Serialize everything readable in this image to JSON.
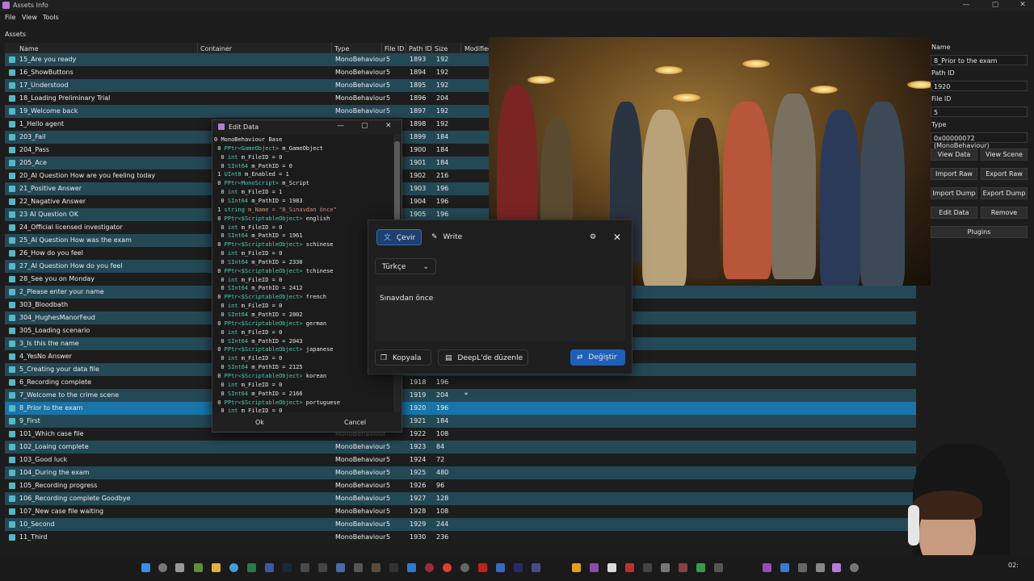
{
  "window": {
    "title": "Assets Info",
    "minimize": "—",
    "maximize": "▢",
    "close": "✕"
  },
  "menu": [
    "File",
    "View",
    "Tools"
  ],
  "assets_label": "Assets",
  "table": {
    "headers": [
      "Name",
      "Container",
      "Type",
      "File ID",
      "Path ID",
      "Size",
      "Modified"
    ],
    "rows": [
      [
        "15_Are you ready",
        "",
        "MonoBehaviour",
        "5",
        "1893",
        "192"
      ],
      [
        "16_ShowButtons",
        "",
        "MonoBehaviour",
        "5",
        "1894",
        "192"
      ],
      [
        "17_Understood",
        "",
        "MonoBehaviour",
        "5",
        "1895",
        "192"
      ],
      [
        "18_Loading Preliminary Trial",
        "",
        "MonoBehaviour",
        "5",
        "1896",
        "204"
      ],
      [
        "19_Welcome back",
        "",
        "MonoBehaviour",
        "5",
        "1897",
        "192"
      ],
      [
        "1_Hello agent",
        "",
        "",
        "",
        "1898",
        "192"
      ],
      [
        "203_Fail",
        "",
        "",
        "",
        "1899",
        "184"
      ],
      [
        "204_Pass",
        "",
        "",
        "",
        "1900",
        "184"
      ],
      [
        "205_Ace",
        "",
        "",
        "",
        "1901",
        "184"
      ],
      [
        "20_AI Question How are you feeling today",
        "",
        "",
        "",
        "1902",
        "216"
      ],
      [
        "21_Positive Answer",
        "",
        "",
        "",
        "1903",
        "196"
      ],
      [
        "22_Nagative Answer",
        "",
        "",
        "",
        "1904",
        "196"
      ],
      [
        "23 AI Question OK",
        "",
        "",
        "",
        "1905",
        "196"
      ],
      [
        "24_Official licensed investigator",
        "",
        "",
        "",
        "",
        ""
      ],
      [
        "25_AI Question How was the exam",
        "",
        "",
        "",
        "",
        ""
      ],
      [
        "26_How do you feel",
        "",
        "",
        "",
        "",
        ""
      ],
      [
        "27_AI Question How do you feel",
        "",
        "",
        "",
        "",
        ""
      ],
      [
        "28_See you on Monday",
        "",
        "",
        "",
        "",
        ""
      ],
      [
        "2_Please enter your name",
        "",
        "",
        "",
        "",
        ""
      ],
      [
        "303_Bloodbath",
        "",
        "",
        "",
        "",
        ""
      ],
      [
        "304_HughesManorFeud",
        "",
        "",
        "",
        "",
        ""
      ],
      [
        "305_Loading scenario",
        "",
        "",
        "",
        "",
        ""
      ],
      [
        "3_Is this the name",
        "",
        "",
        "",
        "",
        ""
      ],
      [
        "4_YesNo Answer",
        "",
        "",
        "",
        "",
        ""
      ],
      [
        "5_Creating your data file",
        "",
        "",
        "",
        "",
        ""
      ],
      [
        "6_Recording complete",
        "",
        "",
        "",
        "1918",
        "196"
      ],
      [
        "7_Welcome to the crime scene",
        "",
        "",
        "",
        "1919",
        "204"
      ],
      [
        "8_Prior to the exam",
        "",
        "",
        "",
        "1920",
        "196"
      ],
      [
        "9_First",
        "",
        "",
        "",
        "1921",
        "184"
      ],
      [
        "101_Which case file",
        "",
        "MonoBehaviour",
        "",
        "1922",
        "108"
      ],
      [
        "102_Loaing complete",
        "",
        "MonoBehaviour",
        "5",
        "1923",
        "84"
      ],
      [
        "103_Good luck",
        "",
        "MonoBehaviour",
        "5",
        "1924",
        "72"
      ],
      [
        "104_During the exam",
        "",
        "MonoBehaviour",
        "5",
        "1925",
        "480"
      ],
      [
        "105_Recording progress",
        "",
        "MonoBehaviour",
        "5",
        "1926",
        "96"
      ],
      [
        "106_Recording complete Goodbye",
        "",
        "MonoBehaviour",
        "5",
        "1927",
        "128"
      ],
      [
        "107_New case file waiting",
        "",
        "MonoBehaviour",
        "5",
        "1928",
        "108"
      ],
      [
        "10_Second",
        "",
        "MonoBehaviour",
        "5",
        "1929",
        "244"
      ],
      [
        "11_Third",
        "",
        "MonoBehaviour",
        "5",
        "1930",
        "236"
      ]
    ],
    "modified_mark": "*"
  },
  "right_panel": {
    "name_label": "Name",
    "name_value": "8_Prior to the exam",
    "pathid_label": "Path ID",
    "pathid_value": "1920",
    "fileid_label": "File ID",
    "fileid_value": "5",
    "type_label": "Type",
    "type_value": "0x00000072 (MonoBehaviour)",
    "buttons": [
      "View Data",
      "View Scene",
      "Import Raw",
      "Export Raw",
      "Import Dump",
      "Export Dump",
      "Edit Data",
      "Remove",
      "Plugins"
    ]
  },
  "edit_dialog": {
    "title": "Edit Data",
    "ok": "Ok",
    "cancel": "Cancel",
    "lines": [
      [
        "0 ",
        "MonoBehaviour Base",
        ""
      ],
      [
        " 0 ",
        "PPtr<GameObject>",
        " m_GameObject"
      ],
      [
        "  0 ",
        "int",
        " m_FileID = 0"
      ],
      [
        "  0 ",
        "SInt64",
        " m_PathID = 0"
      ],
      [
        " 1 ",
        "UInt8",
        " m_Enabled = 1"
      ],
      [
        " 0 ",
        "PPtr<MonoScript>",
        " m_Script"
      ],
      [
        "  0 ",
        "int",
        " m_FileID = 1"
      ],
      [
        "  0 ",
        "SInt64",
        " m_PathID = 1983"
      ],
      [
        " 1 ",
        "string",
        " m_Name = \"8_Sınavdan önce\""
      ],
      [
        " 0 ",
        "PPtr<$ScriptableObject>",
        " english"
      ],
      [
        "  0 ",
        "int",
        " m_FileID = 0"
      ],
      [
        "  0 ",
        "SInt64",
        " m_PathID = 1961"
      ],
      [
        " 0 ",
        "PPtr<$ScriptableObject>",
        " schinese"
      ],
      [
        "  0 ",
        "int",
        " m_FileID = 0"
      ],
      [
        "  0 ",
        "SInt64",
        " m_PathID = 2330"
      ],
      [
        " 0 ",
        "PPtr<$ScriptableObject>",
        " tchinese"
      ],
      [
        "  0 ",
        "int",
        " m_FileID = 0"
      ],
      [
        "  0 ",
        "SInt64",
        " m_PathID = 2412"
      ],
      [
        " 0 ",
        "PPtr<$ScriptableObject>",
        " french"
      ],
      [
        "  0 ",
        "int",
        " m_FileID = 0"
      ],
      [
        "  0 ",
        "SInt64",
        " m_PathID = 2002"
      ],
      [
        " 0 ",
        "PPtr<$ScriptableObject>",
        " german"
      ],
      [
        "  0 ",
        "int",
        " m_FileID = 0"
      ],
      [
        "  0 ",
        "SInt64",
        " m_PathID = 2043"
      ],
      [
        " 0 ",
        "PPtr<$ScriptableObject>",
        " japanese"
      ],
      [
        "  0 ",
        "int",
        " m_FileID = 0"
      ],
      [
        "  0 ",
        "SInt64",
        " m_PathID = 2125"
      ],
      [
        " 0 ",
        "PPtr<$ScriptableObject>",
        " korean"
      ],
      [
        "  0 ",
        "int",
        " m_FileID = 0"
      ],
      [
        "  0 ",
        "SInt64",
        " m_PathID = 2166"
      ],
      [
        " 0 ",
        "PPtr<$ScriptableObject>",
        " portuguese"
      ],
      [
        "  0 ",
        "int",
        " m_FileID = 0"
      ]
    ]
  },
  "translator": {
    "tab_translate": "Çevir",
    "tab_write": "Write",
    "language": "Türkçe",
    "text": "Sınavdan önce",
    "copy": "Kopyala",
    "edit_in_deepl": "DeepL'de düzenle",
    "replace": "Değiştir"
  },
  "taskbar_time": "02:",
  "colors": {
    "row_alt": "#244956",
    "row_selected": "#1a74a8",
    "accent_blue": "#1f5fb8"
  }
}
